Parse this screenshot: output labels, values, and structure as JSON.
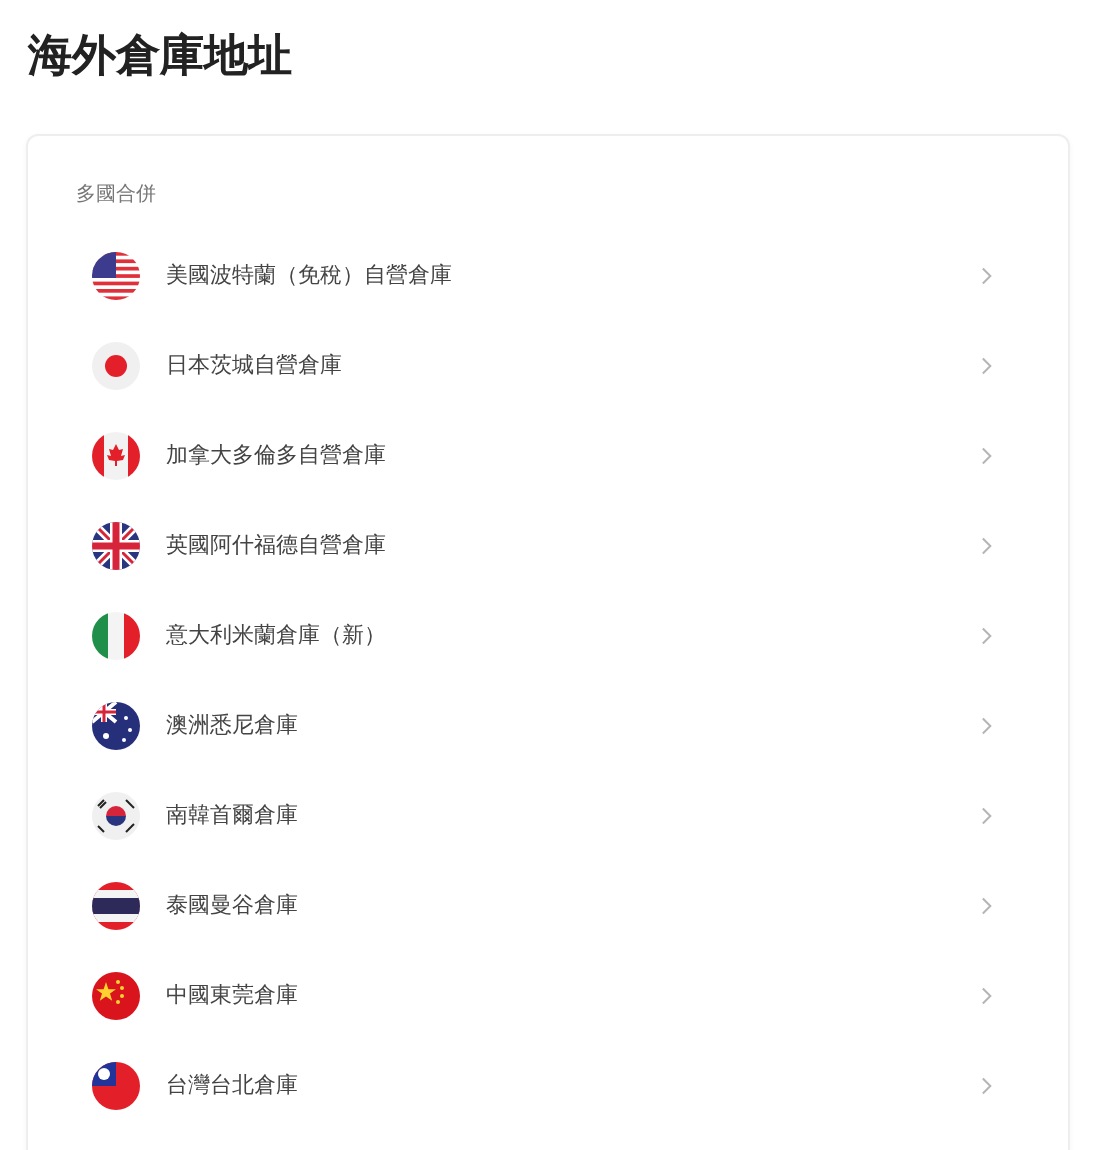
{
  "title": "海外倉庫地址",
  "section": {
    "label": "多國合併",
    "items": [
      {
        "name": "美國波特蘭（免稅）自營倉庫",
        "kind": "us"
      },
      {
        "name": "日本茨城自營倉庫",
        "kind": "jp"
      },
      {
        "name": "加拿大多倫多自營倉庫",
        "kind": "ca"
      },
      {
        "name": "英國阿什福德自營倉庫",
        "kind": "uk"
      },
      {
        "name": "意大利米蘭倉庫（新）",
        "kind": "it"
      },
      {
        "name": "澳洲悉尼倉庫",
        "kind": "au"
      },
      {
        "name": "南韓首爾倉庫",
        "kind": "kr"
      },
      {
        "name": "泰國曼谷倉庫",
        "kind": "th"
      },
      {
        "name": "中國東莞倉庫",
        "kind": "cn"
      },
      {
        "name": "台灣台北倉庫",
        "kind": "tw"
      }
    ]
  }
}
